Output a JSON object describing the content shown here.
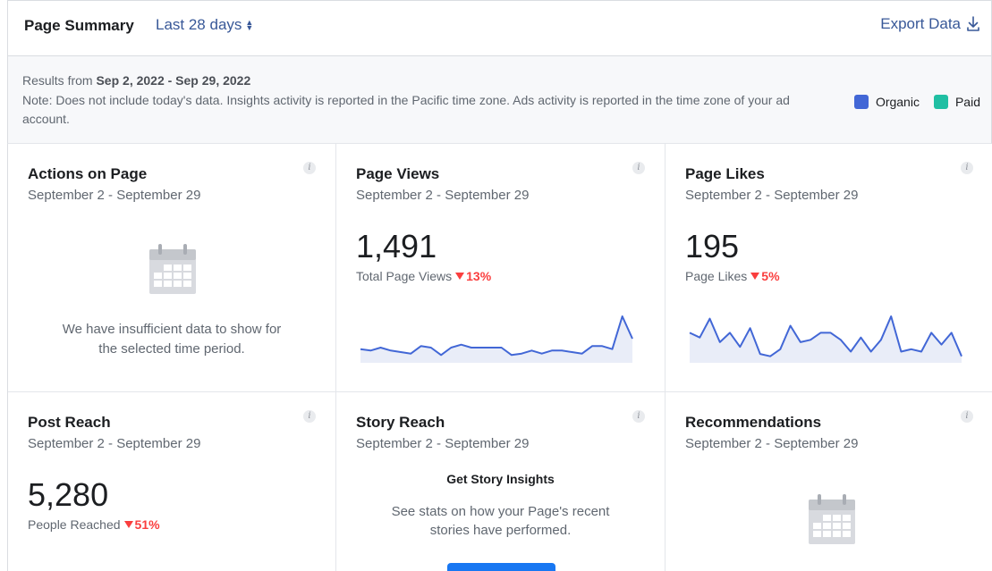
{
  "header": {
    "title": "Page Summary",
    "range": "Last 28 days",
    "export": "Export Data"
  },
  "info": {
    "results_prefix": "Results from",
    "results_range": "Sep 2, 2022 - Sep 29, 2022",
    "note": "Note: Does not include today's data. Insights activity is reported in the Pacific time zone. Ads activity is reported in the time zone of your ad account.",
    "legend": [
      {
        "label": "Organic",
        "color": "#4267d6"
      },
      {
        "label": "Paid",
        "color": "#20bfa3"
      }
    ]
  },
  "cards": {
    "actions": {
      "title": "Actions on Page",
      "date": "September 2 - September 29",
      "empty_line1": "We have insufficient data to show for",
      "empty_line2": "the selected time period."
    },
    "page_views": {
      "title": "Page Views",
      "date": "September 2 - September 29",
      "value": "1,491",
      "label": "Total Page Views",
      "change": "13%"
    },
    "page_likes": {
      "title": "Page Likes",
      "date": "September 2 - September 29",
      "value": "195",
      "label": "Page Likes",
      "change": "5%"
    },
    "post_reach": {
      "title": "Post Reach",
      "date": "September 2 - September 29",
      "value": "5,280",
      "label": "People Reached",
      "change": "51%"
    },
    "story_reach": {
      "title": "Story Reach",
      "date": "September 2 - September 29",
      "heading": "Get Story Insights",
      "desc_line1": "See stats on how your Page's recent",
      "desc_line2": "stories have performed."
    },
    "recommendations": {
      "title": "Recommendations",
      "date": "September 2 - September 29"
    }
  },
  "chart_data": [
    {
      "type": "area",
      "values": [
        8,
        7,
        9,
        7,
        6,
        5,
        10,
        9,
        4,
        9,
        11,
        9,
        9,
        9,
        9,
        4,
        5,
        7,
        5,
        7,
        7,
        6,
        5,
        10,
        10,
        8,
        30,
        15
      ]
    },
    {
      "type": "area",
      "values": [
        12,
        10,
        18,
        8,
        12,
        6,
        14,
        3,
        2,
        5,
        15,
        8,
        9,
        12,
        12,
        9,
        4,
        10,
        4,
        9,
        19,
        4,
        5,
        4,
        12,
        7,
        12,
        2
      ]
    }
  ]
}
